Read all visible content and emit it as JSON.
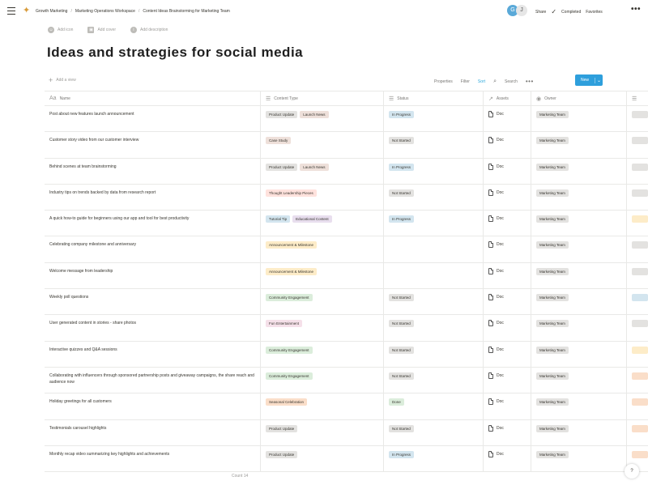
{
  "topbar": {
    "breadcrumbs": [
      "Growth Marketing",
      "Marketing Operations Workspace",
      "Content Ideas Brainstorming for Marketing Team"
    ],
    "avatar_initial": "G",
    "avatar2_initial": "J",
    "share_label": "Share",
    "updates_label": "Completed",
    "favorite_label": "Favorites",
    "more_label": "•••"
  },
  "page": {
    "meta": [
      {
        "icon": "emoji-icon",
        "label": "Add icon"
      },
      {
        "icon": "image-icon",
        "label": "Add cover"
      },
      {
        "icon": "info-icon",
        "label": "Add description"
      }
    ],
    "title": "Ideas and strategies for social media"
  },
  "toolbar": {
    "new_view_label": "Add a view",
    "properties_label": "Properties",
    "filter_label": "Filter",
    "sort_label": "Sort",
    "search_label": "Search",
    "more_label": "•••",
    "new_button_label": "New"
  },
  "table": {
    "columns": [
      {
        "icon": "Aa",
        "label": "Name"
      },
      {
        "icon": "☰",
        "label": "Content Type"
      },
      {
        "icon": "☰",
        "label": "Status"
      },
      {
        "icon": "↗",
        "label": "Assets"
      },
      {
        "icon": "◉",
        "label": "Owner"
      },
      {
        "icon": "☰",
        "label": ""
      }
    ],
    "rows": [
      {
        "name": "Post about new features launch announcement",
        "tags": [
          {
            "t": "Product Update",
            "c": "gray"
          },
          {
            "t": "Launch News",
            "c": "brown"
          }
        ],
        "status": {
          "t": "In Progress",
          "c": "blue"
        },
        "asset": "Doc",
        "owner": "Marketing Team",
        "edge": ""
      },
      {
        "name": "Customer story video from our customer interview",
        "tags": [
          {
            "t": "Case Study",
            "c": "brown"
          }
        ],
        "status": {
          "t": "Not Started",
          "c": "gray"
        },
        "asset": "Doc",
        "owner": "Marketing Team",
        "edge": ""
      },
      {
        "name": "Behind scenes at team brainstorming",
        "tags": [
          {
            "t": "Product Update",
            "c": "gray"
          },
          {
            "t": "Launch News",
            "c": "brown"
          }
        ],
        "status": {
          "t": "In Progress",
          "c": "blue"
        },
        "asset": "Doc",
        "owner": "Marketing Team",
        "edge": ""
      },
      {
        "name": "Industry tips on trends backed by data from research report",
        "tags": [
          {
            "t": "Thought Leadership Pieces",
            "c": "red"
          }
        ],
        "status": {
          "t": "Not Started",
          "c": "gray"
        },
        "asset": "Doc",
        "owner": "Marketing Team",
        "edge": ""
      },
      {
        "name": "A quick how-to guide for beginners using our app and tool for best productivity",
        "tags": [
          {
            "t": "Tutorial Tip",
            "c": "blue"
          },
          {
            "t": "Educational Content",
            "c": "purple"
          }
        ],
        "status": {
          "t": "In Progress",
          "c": "blue"
        },
        "asset": "Doc",
        "owner": "Marketing Team",
        "edge": "yellow"
      },
      {
        "name": "Celebrating company milestone and anniversary",
        "tags": [
          {
            "t": "Announcement & Milestone",
            "c": "yellow"
          }
        ],
        "status": {
          "t": "",
          "c": ""
        },
        "asset": "Doc",
        "owner": "Marketing Team",
        "edge": ""
      },
      {
        "name": "Welcome message from leadership",
        "tags": [
          {
            "t": "Announcement & Milestone",
            "c": "yellow"
          }
        ],
        "status": {
          "t": "",
          "c": ""
        },
        "asset": "Doc",
        "owner": "Marketing Team",
        "edge": ""
      },
      {
        "name": "Weekly poll questions",
        "tags": [
          {
            "t": "Community Engagement",
            "c": "green"
          }
        ],
        "status": {
          "t": "Not Started",
          "c": "gray"
        },
        "asset": "Doc",
        "owner": "Marketing Team",
        "edge": "blue"
      },
      {
        "name": "User generated content in stories - share photos",
        "tags": [
          {
            "t": "Fun Entertainment",
            "c": "pink"
          }
        ],
        "status": {
          "t": "Not Started",
          "c": "gray"
        },
        "asset": "Doc",
        "owner": "Marketing Team",
        "edge": ""
      },
      {
        "name": "Interactive quizzes and Q&A sessions",
        "tags": [
          {
            "t": "Community Engagement",
            "c": "green"
          }
        ],
        "status": {
          "t": "Not Started",
          "c": "gray"
        },
        "asset": "Doc",
        "owner": "Marketing Team",
        "edge": "yellow"
      },
      {
        "name": "Collaborating with influencers through sponsored partnership posts and giveaway campaigns, the share reach and audience now",
        "tags": [
          {
            "t": "Community Engagement",
            "c": "green"
          }
        ],
        "status": {
          "t": "Not Started",
          "c": "gray"
        },
        "asset": "Doc",
        "owner": "Marketing Team",
        "edge": "orange"
      },
      {
        "name": "Holiday greetings for all customers",
        "tags": [
          {
            "t": "Seasonal Celebration",
            "c": "orange"
          }
        ],
        "status": {
          "t": "Done",
          "c": "green"
        },
        "asset": "Doc",
        "owner": "Marketing Team",
        "edge": "orange"
      },
      {
        "name": "Testimonials carousel highlights",
        "tags": [
          {
            "t": "Product Update",
            "c": "gray"
          }
        ],
        "status": {
          "t": "Not Started",
          "c": "gray"
        },
        "asset": "Doc",
        "owner": "Marketing Team",
        "edge": "orange"
      },
      {
        "name": "Monthly recap video summarizing key highlights and achievements",
        "tags": [
          {
            "t": "Product Update",
            "c": "gray"
          }
        ],
        "status": {
          "t": "In Progress",
          "c": "blue"
        },
        "asset": "Doc",
        "owner": "Marketing Team",
        "edge": "orange"
      }
    ]
  },
  "footer": {
    "count_label": "Count 14",
    "help_label": "?"
  },
  "colors": {
    "accent": "#2e9fdc",
    "text": "#37352f",
    "muted": "#9b9a97",
    "border": "#e9e9e7"
  }
}
